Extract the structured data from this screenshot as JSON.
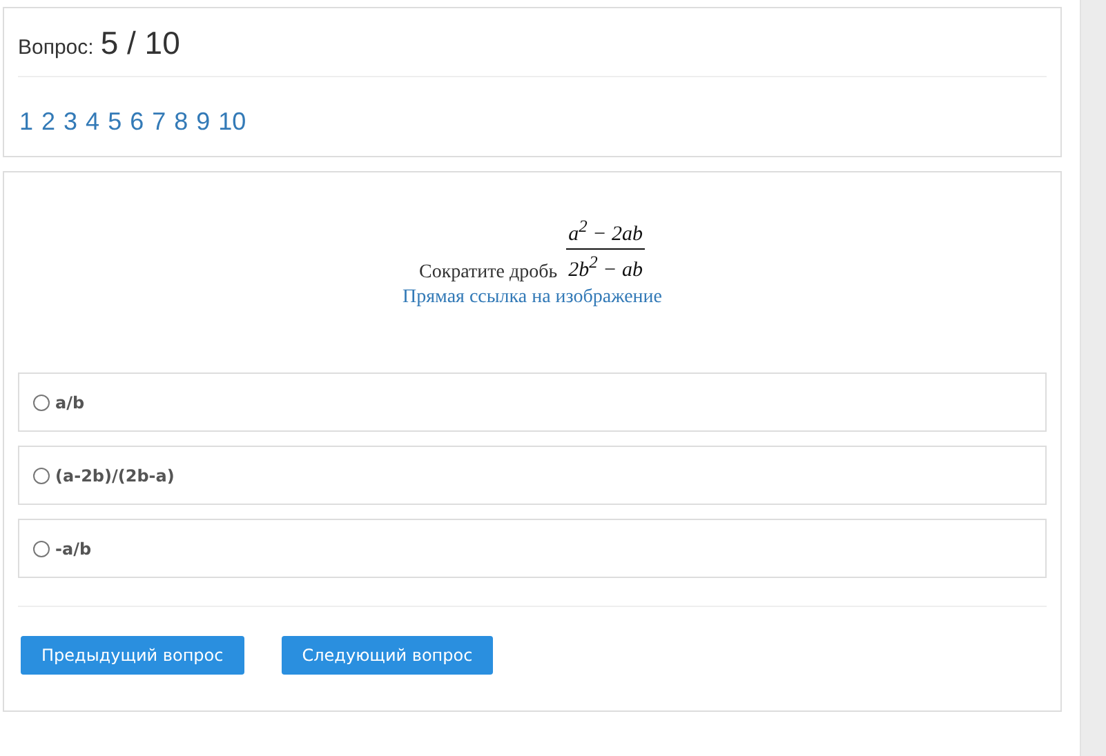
{
  "progress": {
    "label": "Вопрос:",
    "value": "5 / 10"
  },
  "pages": [
    "1",
    "2",
    "3",
    "4",
    "5",
    "6",
    "7",
    "8",
    "9",
    "10"
  ],
  "question": {
    "text": "Сократите дробь",
    "numerator": "a$^{2}$ − 2ab",
    "denominator": "2b$^{2}$ − ab",
    "link": "Прямая ссылка на изображение"
  },
  "options": [
    {
      "label": "a/b",
      "selected": false
    },
    {
      "label": "(a-2b)/(2b-a)",
      "selected": false
    },
    {
      "label": "-a/b",
      "selected": false
    }
  ],
  "buttons": [
    "Предыдущий вопрос",
    "Следующий вопрос"
  ]
}
